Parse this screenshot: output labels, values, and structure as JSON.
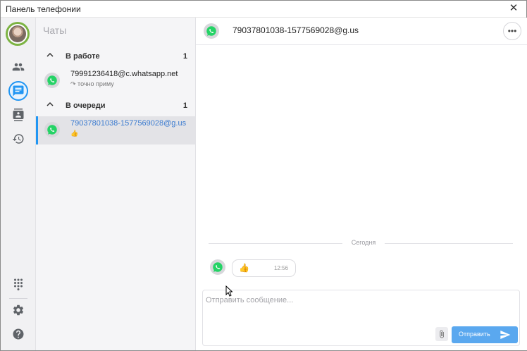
{
  "window": {
    "title": "Панель телефонии",
    "close_glyph": "✕"
  },
  "rail": {
    "items": [
      {
        "name": "contacts",
        "icon": "people-icon"
      },
      {
        "name": "chats",
        "icon": "chat-icon",
        "active": true
      },
      {
        "name": "address-book",
        "icon": "contact-card-icon"
      },
      {
        "name": "history",
        "icon": "history-icon"
      }
    ],
    "bottom": [
      {
        "name": "dialpad",
        "icon": "dialpad-icon"
      },
      {
        "name": "settings",
        "icon": "gear-icon"
      },
      {
        "name": "help",
        "icon": "help-icon"
      }
    ]
  },
  "chats_panel": {
    "title": "Чаты",
    "groups": [
      {
        "name": "В работе",
        "count": "1",
        "items": [
          {
            "name": "79991236418@c.whatsapp.net",
            "sub": "↷ точно приму"
          }
        ]
      },
      {
        "name": "В очереди",
        "count": "1",
        "items": [
          {
            "name": "79037801038-1577569028@g.us",
            "sub": "👍"
          }
        ]
      }
    ]
  },
  "conversation": {
    "title": "79037801038-1577569028@g.us",
    "more_glyph": "•••",
    "day_label": "Сегодня",
    "messages": [
      {
        "text": "👍",
        "time": "12:56"
      }
    ],
    "composer_placeholder": "Отправить сообщение...",
    "send_label": "Отправить"
  },
  "colors": {
    "accent": "#2196f3",
    "send": "#5aa8ef",
    "whatsapp": "#25d366",
    "avatar_ring": "#7cb342"
  }
}
